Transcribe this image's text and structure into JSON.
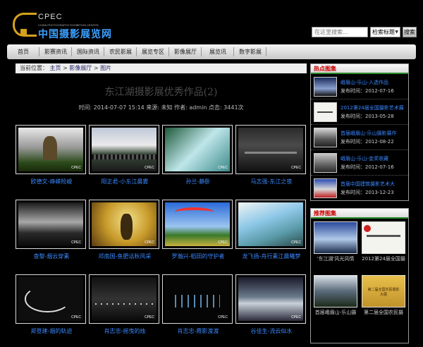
{
  "header": {
    "logo_en": "CPEC",
    "logo_sub": "CHINA PHOTOGRAPHY EXHIBITION CENTER",
    "logo_cn": "中国摄影展览网",
    "search_placeholder": "在这里搜索...",
    "search_select": "检索标题",
    "search_button": "搜索"
  },
  "nav": [
    "首页",
    "影赛资讯",
    "国际资讯",
    "农民影展",
    "展览专区",
    "影像展厅",
    "展览讯",
    "数字影展"
  ],
  "breadcrumb": {
    "prefix": "当前位置：",
    "home": "主页",
    "sep": ">",
    "section": "影像展厅",
    "page": "图片"
  },
  "article": {
    "title": "东江湖摄影展优秀作品(2)",
    "meta": "时间: 2014-07-07 15:14  来源: 未知  作者: admin  点击: 3441次"
  },
  "photos": [
    {
      "caption": "欧德文-峥嵘险峻"
    },
    {
      "caption": "阳正君-小东江晨雾"
    },
    {
      "caption": "孙兰-静卧"
    },
    {
      "caption": "马志强-东江之夜"
    },
    {
      "caption": "查黎-烟云穿素"
    },
    {
      "caption": "邓南国-鱼肥话秋风采"
    },
    {
      "caption": "罗瀚兴-稻田的守护者"
    },
    {
      "caption": "龙飞扬-舟行素江晨曦梦"
    },
    {
      "caption": "郑登建-烟的轨迹"
    },
    {
      "caption": "肖志忠-摇曳的烛"
    },
    {
      "caption": "肖志忠-霞影渡渡"
    },
    {
      "caption": "谷佳生-流云似水"
    }
  ],
  "watermark": "CPEC",
  "hot": {
    "heading": "热点图集",
    "items": [
      {
        "title": "峨眉山-乐山-入选作品",
        "date": "发布时间：2012-07-16"
      },
      {
        "title": "2012第24届全国摄影艺术展",
        "date": "发布时间：2013-05-28"
      },
      {
        "title": "首届峨眉山-乐山摄影展作",
        "date": "发布时间：2012-08-22"
      },
      {
        "title": "峨眉山-乐山-金奖收藏",
        "date": "发布时间：2012-07-16"
      },
      {
        "title": "首届中国建筑摄影艺术大",
        "date": "发布时间：2013-12-23"
      }
    ]
  },
  "recommend": {
    "heading": "推荐图集",
    "items": [
      {
        "caption": "'东江湖'风光风情"
      },
      {
        "caption": "2012第24届全国摄"
      },
      {
        "caption": "首届峨眉山-乐山摄"
      },
      {
        "caption": "第二届全国农民摄"
      }
    ],
    "poster_text": "第二届全国农民摄影大展"
  },
  "colors": {
    "accent_gold": "#d6a21b",
    "link_blue": "#3a88ff",
    "hot_red": "#cc0000",
    "panel_green": "#2a8a2a"
  }
}
